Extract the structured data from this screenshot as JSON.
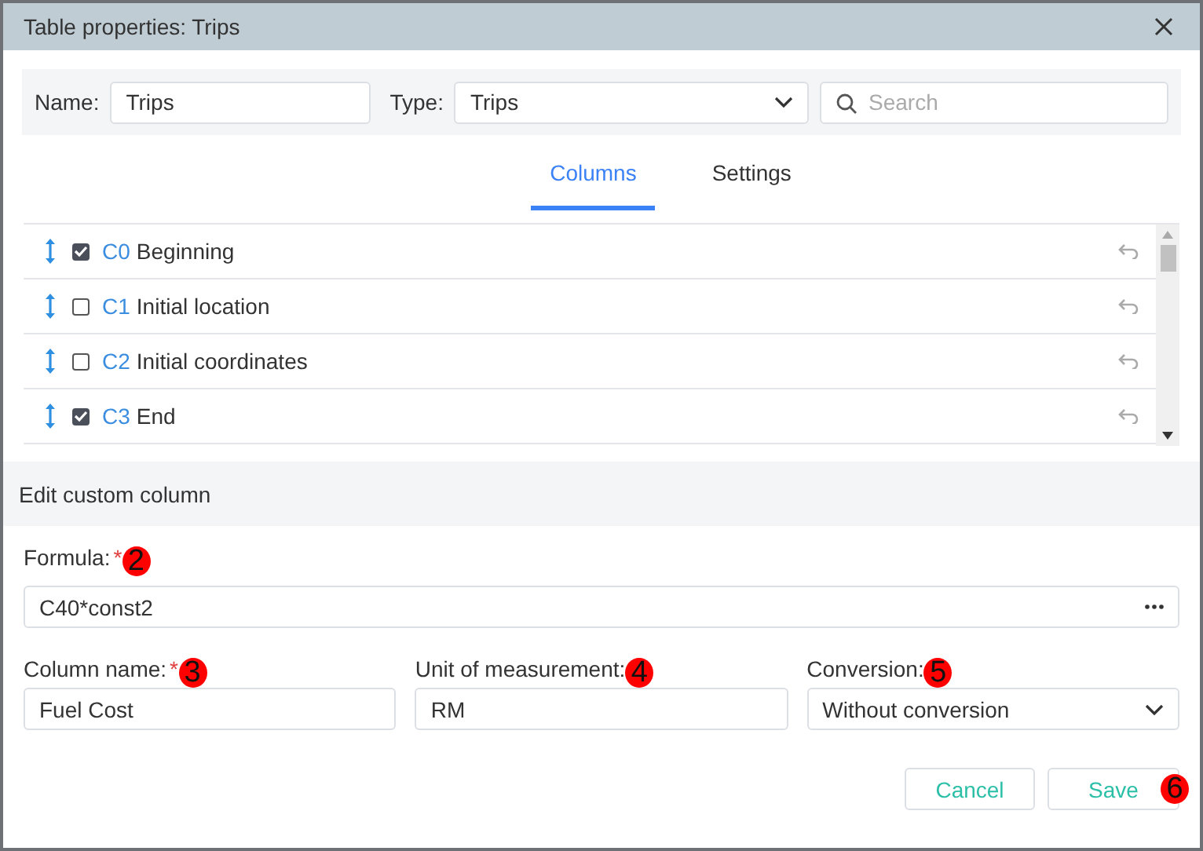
{
  "window": {
    "title": "Table properties: Trips"
  },
  "toolbar": {
    "name_label": "Name:",
    "name_value": "Trips",
    "type_label": "Type:",
    "type_value": "Trips",
    "search": {
      "placeholder": "Search"
    }
  },
  "tabs": [
    {
      "label": "Columns",
      "selected": true
    },
    {
      "label": "Settings",
      "selected": false
    }
  ],
  "columns": [
    {
      "code": "C0",
      "name": "Beginning",
      "checked": true
    },
    {
      "code": "C1",
      "name": "Initial location",
      "checked": false
    },
    {
      "code": "C2",
      "name": "Initial coordinates",
      "checked": false
    },
    {
      "code": "C3",
      "name": "End",
      "checked": true
    }
  ],
  "editor": {
    "title": "Edit custom column",
    "formula": {
      "label": "Formula:",
      "required_mark": "*",
      "marker": "2",
      "value": "C40*const2"
    },
    "fields": [
      {
        "kind": "text",
        "label": "Column name:",
        "required_mark": "*",
        "marker": "3",
        "value": "Fuel Cost"
      },
      {
        "kind": "text",
        "label": "Unit of measurement:",
        "marker": "4",
        "value": "RM"
      },
      {
        "kind": "select",
        "label": "Conversion:",
        "marker": "5",
        "value": "Without conversion"
      }
    ]
  },
  "buttons": [
    {
      "label": "Cancel"
    },
    {
      "label": "Save",
      "marker": "6"
    }
  ]
}
